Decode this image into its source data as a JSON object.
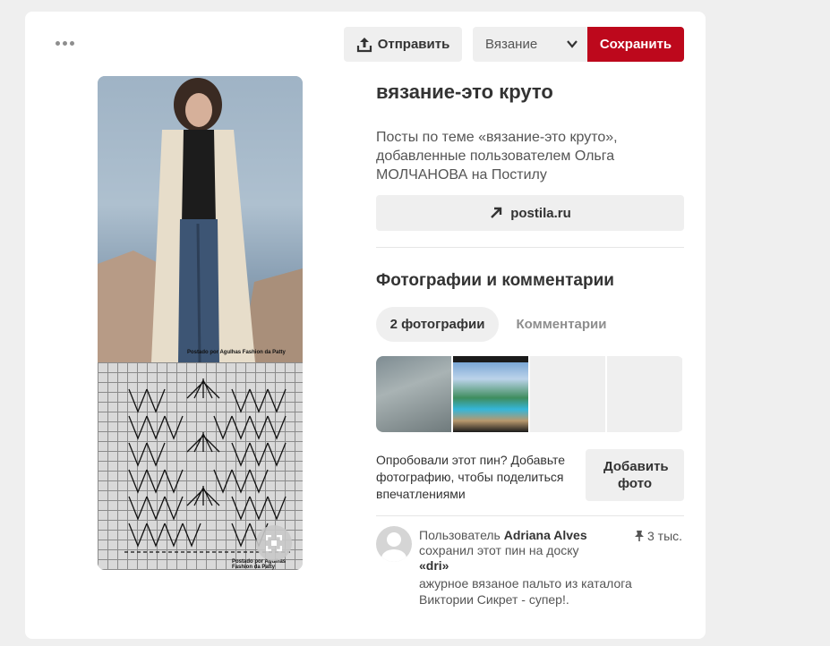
{
  "toolbar": {
    "send_label": "Отправить",
    "board_selected": "Вязание",
    "save_label": "Сохранить",
    "save_color": "#bd081c"
  },
  "pin": {
    "image_credit": "Postado por Agulhas Fashion da Patty",
    "image_credit_bottom": "Postado por Agulhas Fashion da Patty",
    "title": "вязание-это круто",
    "description": "Посты по теме «вязание-это круто», добавленные пользователем Ольга МОЛЧАНОВА на Постилу",
    "link_label": "postila.ru"
  },
  "photos_section": {
    "title": "Фотографии и комментарии",
    "tabs": [
      {
        "label": "2 фотографии",
        "active": true
      },
      {
        "label": "Комментарии",
        "active": false
      }
    ]
  },
  "tried": {
    "text": "Опробовали этот пин? Добавьте фотографию, чтобы поделиться впечатлениями",
    "button_label": "Добавить фото"
  },
  "activity": {
    "prefix": "Пользователь",
    "user_name": "Adriana Alves",
    "middle": "сохранил этот пин на доску",
    "board": "«dri»",
    "save_count": "3 тыс.",
    "comment": "ажурное вязаное пальто из каталога Виктории Сикрет - супер!."
  },
  "icons": {
    "more": "more-dots-icon",
    "send": "share-upload-icon",
    "chevron": "chevron-down-icon",
    "link": "arrow-up-right-icon",
    "pin": "pushpin-icon",
    "expand": "expand-icon"
  }
}
